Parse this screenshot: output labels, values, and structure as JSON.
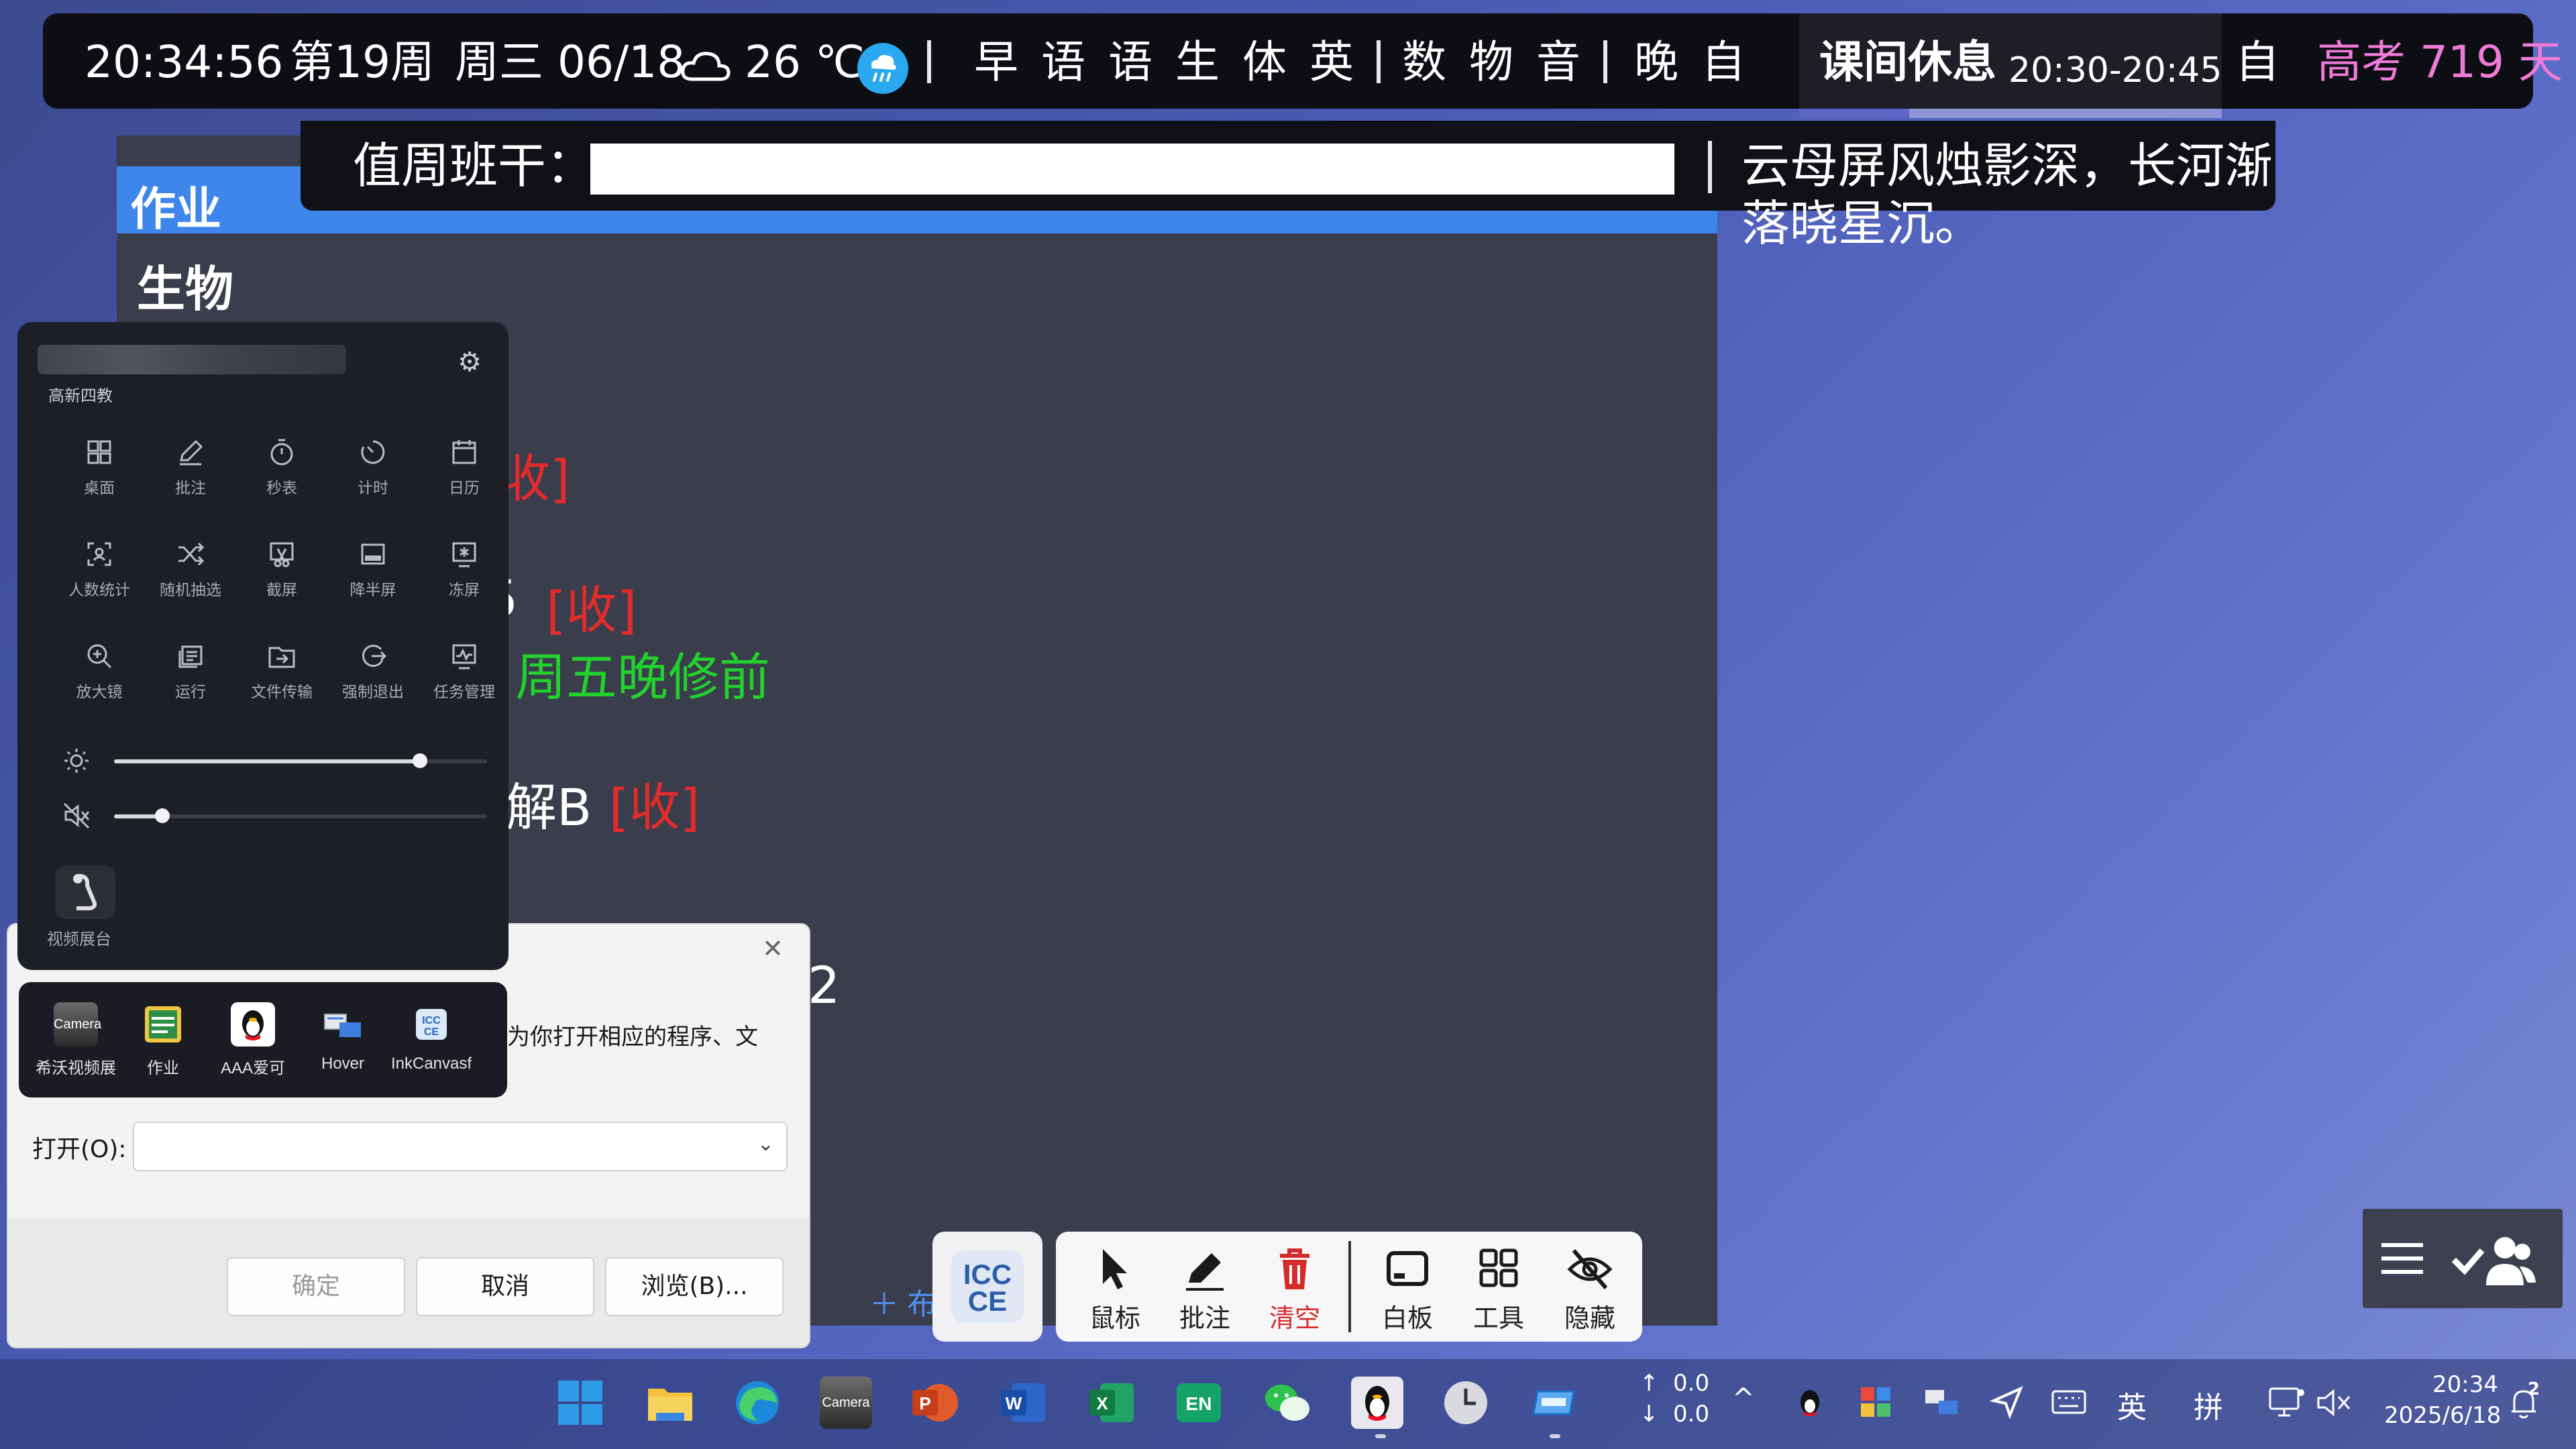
{
  "status_bar": {
    "time": "20:34:56",
    "week": "第19周",
    "date": "周三 06/18",
    "temperature": "26 ℃",
    "schedule_morning": [
      "早",
      "语",
      "语",
      "生",
      "体",
      "英"
    ],
    "schedule_afternoon": [
      "数",
      "物",
      "音"
    ],
    "schedule_evening": [
      "晚",
      "自"
    ],
    "current_period": "课间休息",
    "current_period_time": "20:30-20:45",
    "next_period": "自",
    "countdown": "高考 719 天",
    "progress_fraction": 0.26,
    "countdown_color": "#f07ad8",
    "weather_icon": "cloud-icon",
    "rain_icon": "rain-icon"
  },
  "duty_banner": {
    "label": "值周班干：",
    "poem": "云母屏风烛影深，长河渐落晓星沉。"
  },
  "homework": {
    "title": "作业",
    "subject": "生物",
    "lines": [
      {
        "text": "收]",
        "color": "red"
      },
      {
        "text": "5",
        "color": "white"
      },
      {
        "text": "[收]",
        "color": "red"
      },
      {
        "text": "周五晚修前",
        "color": "green"
      },
      {
        "text": "解B",
        "color": "white"
      },
      {
        "text": "[收]",
        "color": "red"
      },
      {
        "text": "2",
        "color": "white"
      }
    ],
    "add_label": "＋ 布"
  },
  "quick_panel": {
    "school": "高新四教",
    "tools": [
      {
        "label": "桌面",
        "icon": "desktop-icon"
      },
      {
        "label": "批注",
        "icon": "pen-icon"
      },
      {
        "label": "秒表",
        "icon": "stopwatch-icon"
      },
      {
        "label": "计时",
        "icon": "timer-icon"
      },
      {
        "label": "日历",
        "icon": "calendar-icon"
      },
      {
        "label": "人数统计",
        "icon": "people-count-icon"
      },
      {
        "label": "随机抽选",
        "icon": "shuffle-icon"
      },
      {
        "label": "截屏",
        "icon": "screenshot-icon"
      },
      {
        "label": "降半屏",
        "icon": "half-screen-icon"
      },
      {
        "label": "冻屏",
        "icon": "freeze-icon"
      },
      {
        "label": "放大镜",
        "icon": "magnifier-icon"
      },
      {
        "label": "运行",
        "icon": "run-icon"
      },
      {
        "label": "文件传输",
        "icon": "file-transfer-icon"
      },
      {
        "label": "强制退出",
        "icon": "force-exit-icon"
      },
      {
        "label": "任务管理",
        "icon": "task-manager-icon"
      }
    ],
    "brightness": 0.82,
    "volume": 0.13,
    "video_booth_label": "视频展台"
  },
  "run_dialog": {
    "description": "为你打开相应的程序、文",
    "open_label": "打开(O):",
    "open_value": "",
    "ok": "确定",
    "cancel": "取消",
    "browse": "浏览(B)..."
  },
  "app_bar": [
    {
      "label": "希沃视频展",
      "icon": "camera-app-icon"
    },
    {
      "label": "作业",
      "icon": "homework-app-icon"
    },
    {
      "label": "AAA爱可",
      "icon": "qq-penguin-icon"
    },
    {
      "label": "Hover",
      "icon": "hover-app-icon"
    },
    {
      "label": "InkCanvasf",
      "icon": "inkcanvas-app-icon"
    }
  ],
  "ink_toolbar": {
    "logo": "ICC CE",
    "buttons": [
      {
        "label": "鼠标",
        "icon": "cursor-icon"
      },
      {
        "label": "批注",
        "icon": "pen-icon"
      },
      {
        "label": "清空",
        "icon": "trash-icon",
        "color": "#d62b2b"
      },
      {
        "label": "白板",
        "icon": "whiteboard-icon"
      },
      {
        "label": "工具",
        "icon": "grid-icon"
      },
      {
        "label": "隐藏",
        "icon": "eye-off-icon"
      }
    ]
  },
  "taskbar": {
    "net_up": "0.0",
    "net_down": "0.0",
    "ime_lang": "英",
    "ime_mode": "拼",
    "clock_time": "20:34",
    "clock_date": "2025/6/18",
    "notification_count": "2"
  }
}
